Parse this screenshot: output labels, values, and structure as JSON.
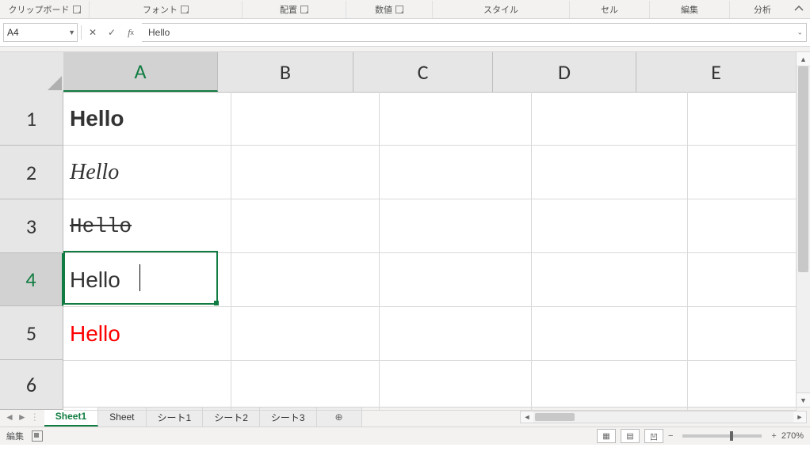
{
  "ribbon": {
    "groups": [
      "クリップボード",
      "フォント",
      "配置",
      "数値",
      "スタイル",
      "セル",
      "編集",
      "分析"
    ]
  },
  "name_box": "A4",
  "formula_bar": "Hello",
  "columns": [
    "A",
    "B",
    "C",
    "D",
    "E"
  ],
  "rows": [
    "1",
    "2",
    "3",
    "4",
    "5",
    "6"
  ],
  "active_cell": "A4",
  "cells": {
    "A1": "Hello",
    "A2": "Hello",
    "A3": "Hello",
    "A4": "Hello",
    "A5": "Hello"
  },
  "tabs": {
    "items": [
      "Sheet1",
      "Sheet",
      "シート1",
      "シート2",
      "シート3"
    ],
    "active": 0
  },
  "status": {
    "mode": "編集"
  },
  "zoom": "270%"
}
